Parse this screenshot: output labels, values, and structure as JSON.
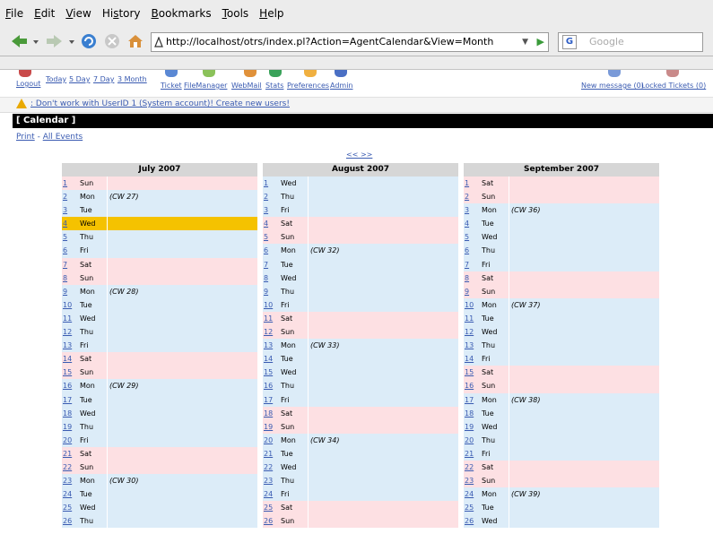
{
  "browser": {
    "menus": [
      {
        "pre": "",
        "u": "F",
        "post": "ile"
      },
      {
        "pre": "",
        "u": "E",
        "post": "dit"
      },
      {
        "pre": "",
        "u": "V",
        "post": "iew"
      },
      {
        "pre": "Hi",
        "u": "s",
        "post": "tory"
      },
      {
        "pre": "",
        "u": "B",
        "post": "ookmarks"
      },
      {
        "pre": "",
        "u": "T",
        "post": "ools"
      },
      {
        "pre": "",
        "u": "H",
        "post": "elp"
      }
    ],
    "url": "http://localhost/otrs/index.pl?Action=AgentCalendar&View=Month",
    "search_placeholder": "Google"
  },
  "otrs": {
    "nav_left": [
      "Logout",
      "Today",
      "5 Day",
      "7 Day",
      "3 Month"
    ],
    "nav_modules": [
      "Ticket",
      "FileManager",
      "WebMail",
      "Stats",
      "Preferences",
      "Admin"
    ],
    "nav_right": [
      "New message (0)",
      "Locked Tickets (0)"
    ],
    "warning": ": Don't work with UserID 1 (System account)! Create new users!",
    "heading": "[ Calendar ]",
    "submenu": {
      "print": "Print",
      "sep": " - ",
      "all": "All Events"
    },
    "prevnext": "<< >>"
  },
  "colors": {
    "weekday": "#dcecf8",
    "weekend": "#fde0e3",
    "today": "#f5c200",
    "link": "#3a5bb1"
  },
  "calendar": [
    {
      "title": "July 2007",
      "rows": [
        {
          "n": "1",
          "d": "Sun",
          "cw": "",
          "t": "we"
        },
        {
          "n": "2",
          "d": "Mon",
          "cw": "(CW 27)",
          "t": "wd"
        },
        {
          "n": "3",
          "d": "Tue",
          "cw": "",
          "t": "wd"
        },
        {
          "n": "4",
          "d": "Wed",
          "cw": "",
          "t": "today"
        },
        {
          "n": "5",
          "d": "Thu",
          "cw": "",
          "t": "wd"
        },
        {
          "n": "6",
          "d": "Fri",
          "cw": "",
          "t": "wd"
        },
        {
          "n": "7",
          "d": "Sat",
          "cw": "",
          "t": "we"
        },
        {
          "n": "8",
          "d": "Sun",
          "cw": "",
          "t": "we"
        },
        {
          "n": "9",
          "d": "Mon",
          "cw": "(CW 28)",
          "t": "wd"
        },
        {
          "n": "10",
          "d": "Tue",
          "cw": "",
          "t": "wd"
        },
        {
          "n": "11",
          "d": "Wed",
          "cw": "",
          "t": "wd"
        },
        {
          "n": "12",
          "d": "Thu",
          "cw": "",
          "t": "wd"
        },
        {
          "n": "13",
          "d": "Fri",
          "cw": "",
          "t": "wd"
        },
        {
          "n": "14",
          "d": "Sat",
          "cw": "",
          "t": "we"
        },
        {
          "n": "15",
          "d": "Sun",
          "cw": "",
          "t": "we"
        },
        {
          "n": "16",
          "d": "Mon",
          "cw": "(CW 29)",
          "t": "wd"
        },
        {
          "n": "17",
          "d": "Tue",
          "cw": "",
          "t": "wd"
        },
        {
          "n": "18",
          "d": "Wed",
          "cw": "",
          "t": "wd"
        },
        {
          "n": "19",
          "d": "Thu",
          "cw": "",
          "t": "wd"
        },
        {
          "n": "20",
          "d": "Fri",
          "cw": "",
          "t": "wd"
        },
        {
          "n": "21",
          "d": "Sat",
          "cw": "",
          "t": "we"
        },
        {
          "n": "22",
          "d": "Sun",
          "cw": "",
          "t": "we"
        },
        {
          "n": "23",
          "d": "Mon",
          "cw": "(CW 30)",
          "t": "wd"
        },
        {
          "n": "24",
          "d": "Tue",
          "cw": "",
          "t": "wd"
        },
        {
          "n": "25",
          "d": "Wed",
          "cw": "",
          "t": "wd"
        },
        {
          "n": "26",
          "d": "Thu",
          "cw": "",
          "t": "wd"
        }
      ]
    },
    {
      "title": "August 2007",
      "rows": [
        {
          "n": "1",
          "d": "Wed",
          "cw": "",
          "t": "wd"
        },
        {
          "n": "2",
          "d": "Thu",
          "cw": "",
          "t": "wd"
        },
        {
          "n": "3",
          "d": "Fri",
          "cw": "",
          "t": "wd"
        },
        {
          "n": "4",
          "d": "Sat",
          "cw": "",
          "t": "we"
        },
        {
          "n": "5",
          "d": "Sun",
          "cw": "",
          "t": "we"
        },
        {
          "n": "6",
          "d": "Mon",
          "cw": "(CW 32)",
          "t": "wd"
        },
        {
          "n": "7",
          "d": "Tue",
          "cw": "",
          "t": "wd"
        },
        {
          "n": "8",
          "d": "Wed",
          "cw": "",
          "t": "wd"
        },
        {
          "n": "9",
          "d": "Thu",
          "cw": "",
          "t": "wd"
        },
        {
          "n": "10",
          "d": "Fri",
          "cw": "",
          "t": "wd"
        },
        {
          "n": "11",
          "d": "Sat",
          "cw": "",
          "t": "we"
        },
        {
          "n": "12",
          "d": "Sun",
          "cw": "",
          "t": "we"
        },
        {
          "n": "13",
          "d": "Mon",
          "cw": "(CW 33)",
          "t": "wd"
        },
        {
          "n": "14",
          "d": "Tue",
          "cw": "",
          "t": "wd"
        },
        {
          "n": "15",
          "d": "Wed",
          "cw": "",
          "t": "wd"
        },
        {
          "n": "16",
          "d": "Thu",
          "cw": "",
          "t": "wd"
        },
        {
          "n": "17",
          "d": "Fri",
          "cw": "",
          "t": "wd"
        },
        {
          "n": "18",
          "d": "Sat",
          "cw": "",
          "t": "we"
        },
        {
          "n": "19",
          "d": "Sun",
          "cw": "",
          "t": "we"
        },
        {
          "n": "20",
          "d": "Mon",
          "cw": "(CW 34)",
          "t": "wd"
        },
        {
          "n": "21",
          "d": "Tue",
          "cw": "",
          "t": "wd"
        },
        {
          "n": "22",
          "d": "Wed",
          "cw": "",
          "t": "wd"
        },
        {
          "n": "23",
          "d": "Thu",
          "cw": "",
          "t": "wd"
        },
        {
          "n": "24",
          "d": "Fri",
          "cw": "",
          "t": "wd"
        },
        {
          "n": "25",
          "d": "Sat",
          "cw": "",
          "t": "we"
        },
        {
          "n": "26",
          "d": "Sun",
          "cw": "",
          "t": "we"
        }
      ]
    },
    {
      "title": "September 2007",
      "rows": [
        {
          "n": "1",
          "d": "Sat",
          "cw": "",
          "t": "we"
        },
        {
          "n": "2",
          "d": "Sun",
          "cw": "",
          "t": "we"
        },
        {
          "n": "3",
          "d": "Mon",
          "cw": "(CW 36)",
          "t": "wd"
        },
        {
          "n": "4",
          "d": "Tue",
          "cw": "",
          "t": "wd"
        },
        {
          "n": "5",
          "d": "Wed",
          "cw": "",
          "t": "wd"
        },
        {
          "n": "6",
          "d": "Thu",
          "cw": "",
          "t": "wd"
        },
        {
          "n": "7",
          "d": "Fri",
          "cw": "",
          "t": "wd"
        },
        {
          "n": "8",
          "d": "Sat",
          "cw": "",
          "t": "we"
        },
        {
          "n": "9",
          "d": "Sun",
          "cw": "",
          "t": "we"
        },
        {
          "n": "10",
          "d": "Mon",
          "cw": "(CW 37)",
          "t": "wd"
        },
        {
          "n": "11",
          "d": "Tue",
          "cw": "",
          "t": "wd"
        },
        {
          "n": "12",
          "d": "Wed",
          "cw": "",
          "t": "wd"
        },
        {
          "n": "13",
          "d": "Thu",
          "cw": "",
          "t": "wd"
        },
        {
          "n": "14",
          "d": "Fri",
          "cw": "",
          "t": "wd"
        },
        {
          "n": "15",
          "d": "Sat",
          "cw": "",
          "t": "we"
        },
        {
          "n": "16",
          "d": "Sun",
          "cw": "",
          "t": "we"
        },
        {
          "n": "17",
          "d": "Mon",
          "cw": "(CW 38)",
          "t": "wd"
        },
        {
          "n": "18",
          "d": "Tue",
          "cw": "",
          "t": "wd"
        },
        {
          "n": "19",
          "d": "Wed",
          "cw": "",
          "t": "wd"
        },
        {
          "n": "20",
          "d": "Thu",
          "cw": "",
          "t": "wd"
        },
        {
          "n": "21",
          "d": "Fri",
          "cw": "",
          "t": "wd"
        },
        {
          "n": "22",
          "d": "Sat",
          "cw": "",
          "t": "we"
        },
        {
          "n": "23",
          "d": "Sun",
          "cw": "",
          "t": "we"
        },
        {
          "n": "24",
          "d": "Mon",
          "cw": "(CW 39)",
          "t": "wd"
        },
        {
          "n": "25",
          "d": "Tue",
          "cw": "",
          "t": "wd"
        },
        {
          "n": "26",
          "d": "Wed",
          "cw": "",
          "t": "wd"
        }
      ]
    }
  ]
}
